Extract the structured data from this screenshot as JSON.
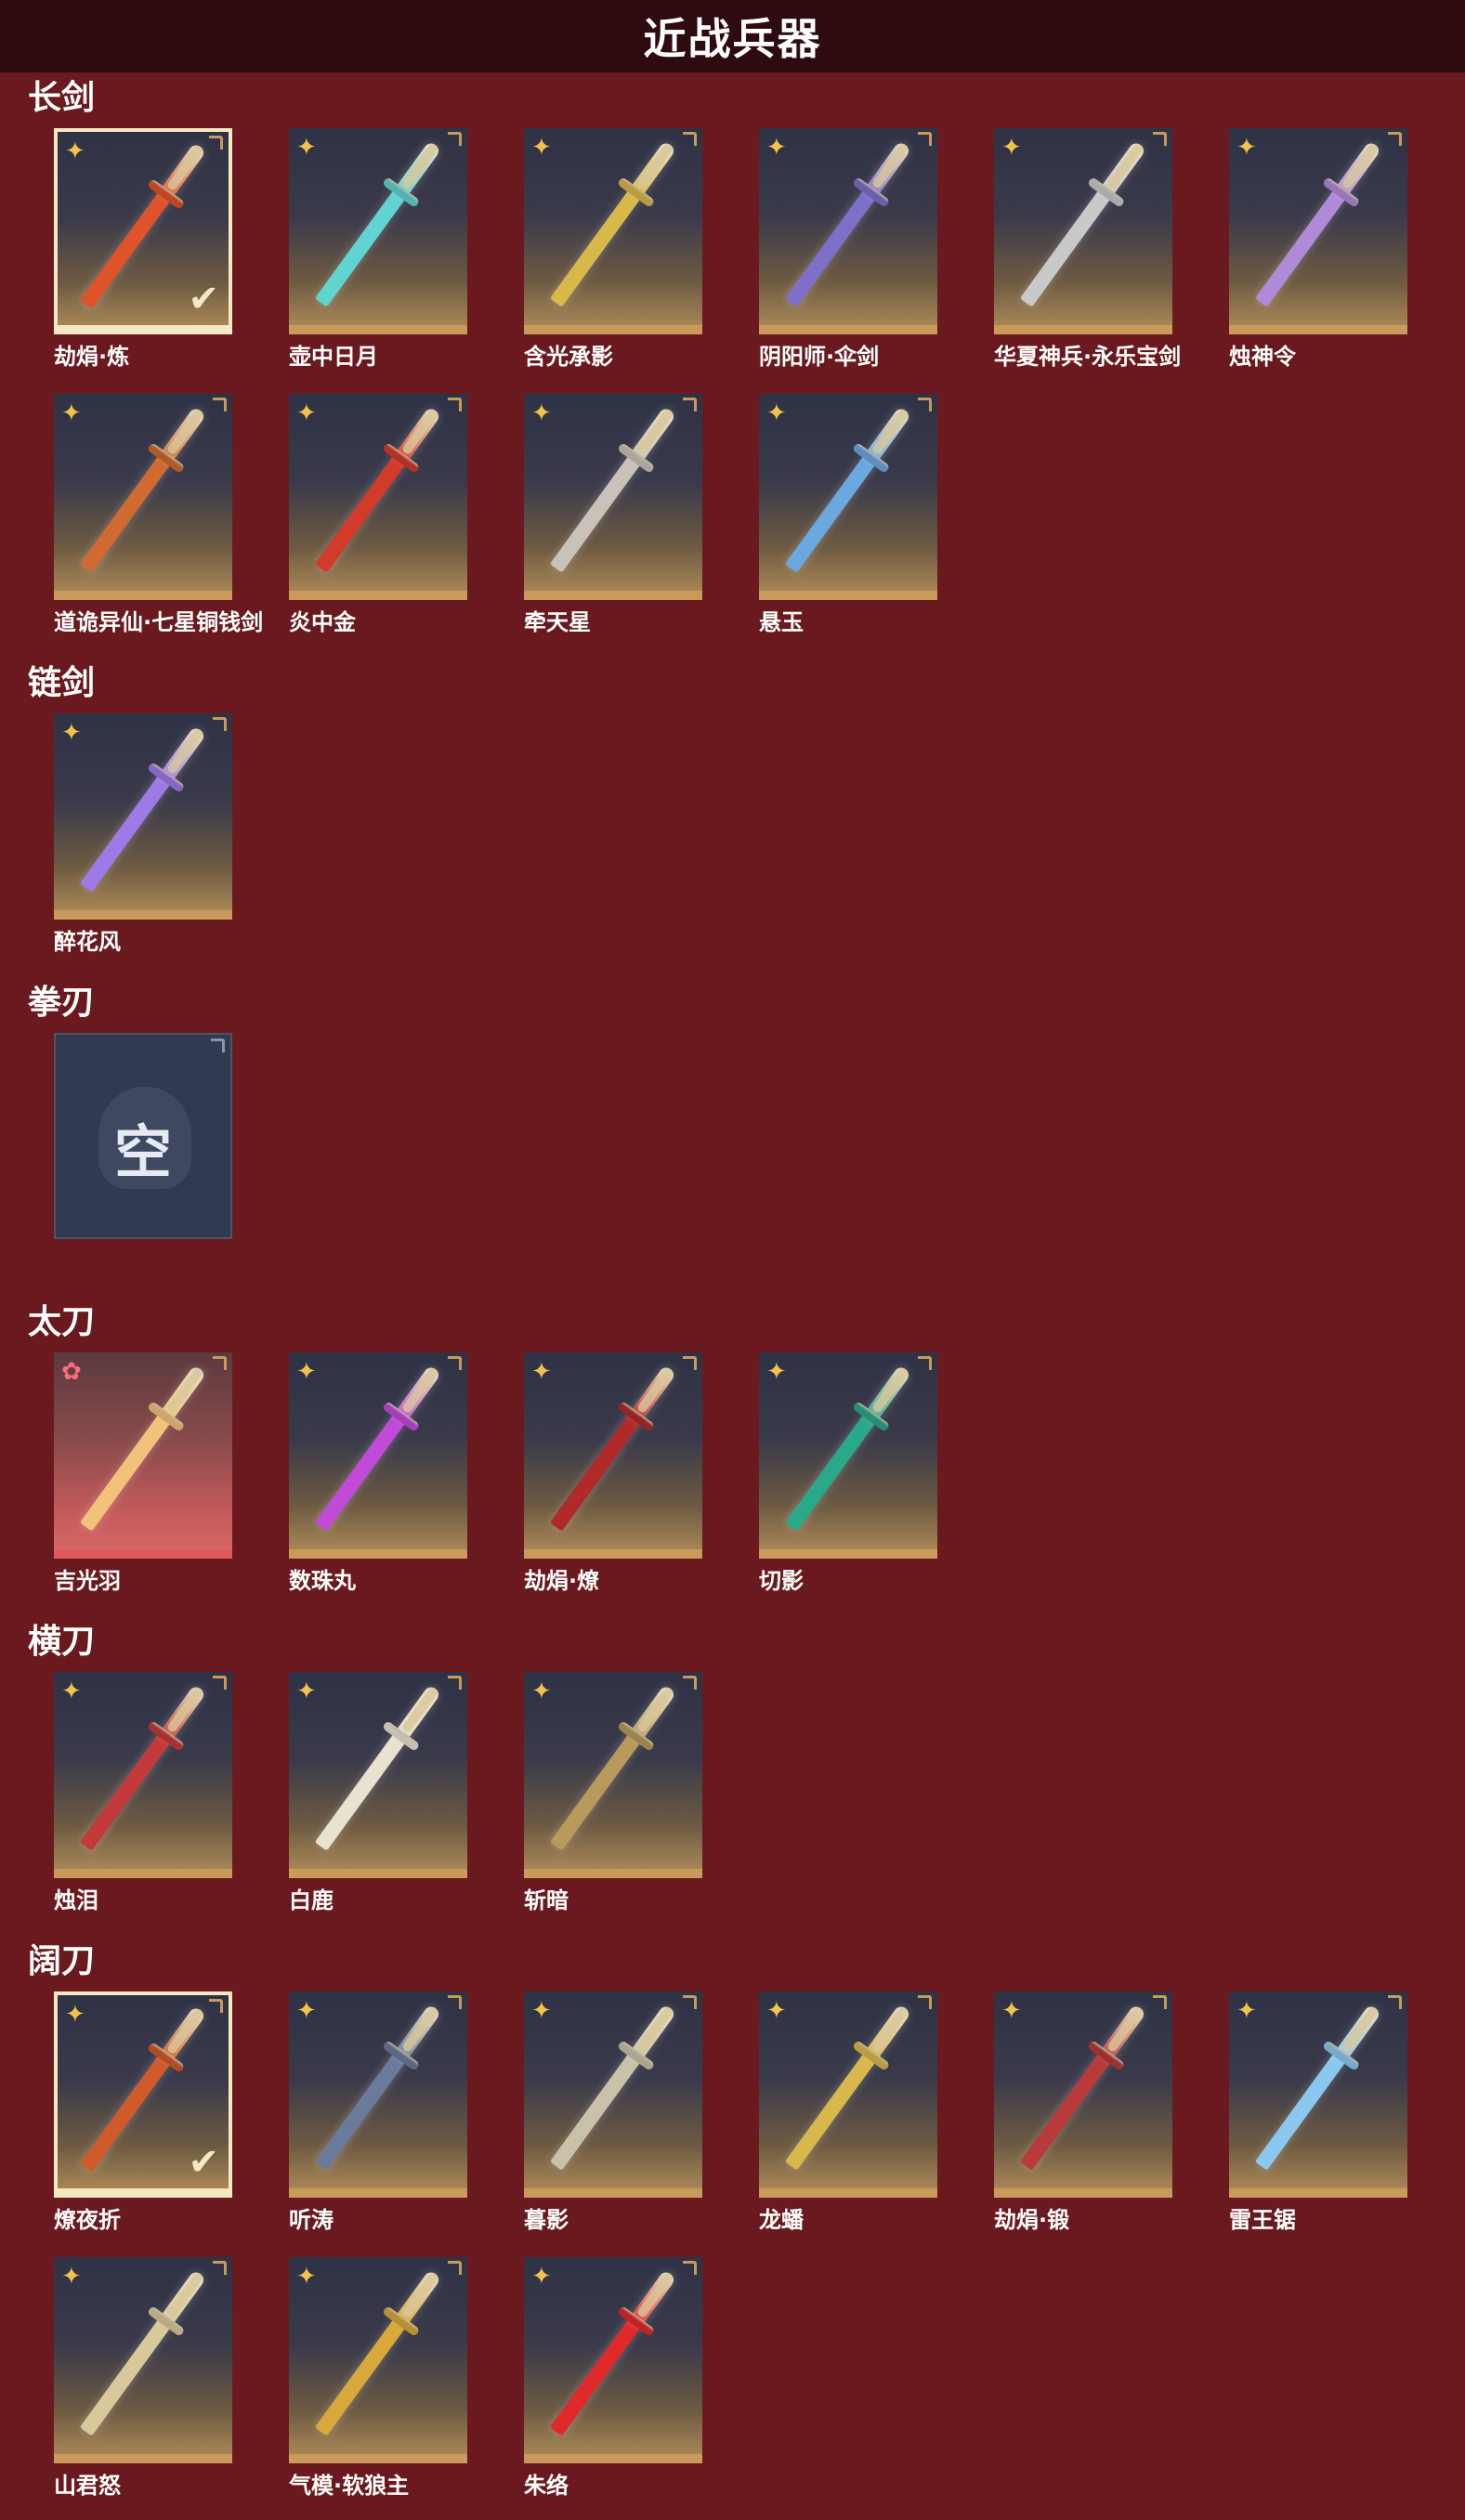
{
  "page": {
    "title": "近战兵器"
  },
  "icons": {
    "rarity": "four-point-star-icon",
    "rarity_pink": "flower-icon",
    "selected": "checkmark-icon",
    "corner": "corner-bracket-icon"
  },
  "colors": {
    "background": "#6a1a1e",
    "header": "#2e0b0e",
    "card_bottom": "#c99a5a",
    "rarity_gold": "#f2c24a",
    "rarity_pink": "#ff6a80"
  },
  "sections": [
    {
      "title": "长剑",
      "items": [
        {
          "name": "劫焆·炼",
          "selected": true,
          "color": "#e0522a"
        },
        {
          "name": "壶中日月",
          "color": "#5fd4d0"
        },
        {
          "name": "含光承影",
          "color": "#d9b84a"
        },
        {
          "name": "阴阳师·伞剑",
          "color": "#7e6fc9"
        },
        {
          "name": "华夏神兵·永乐宝剑",
          "color": "#c9c9c9"
        },
        {
          "name": "烛神令",
          "color": "#b08ad8"
        },
        {
          "name": "道诡异仙·七星铜钱剑",
          "color": "#d06a30"
        },
        {
          "name": "炎中金",
          "color": "#d23a2a"
        },
        {
          "name": "牵天星",
          "color": "#c9c2b8"
        },
        {
          "name": "悬玉",
          "color": "#6aa8e0"
        }
      ]
    },
    {
      "title": "链剑",
      "items": [
        {
          "name": "醉花风",
          "color": "#9d7ae8"
        }
      ]
    },
    {
      "title": "拳刃",
      "items": [
        {
          "empty": true,
          "empty_text": "空"
        }
      ]
    },
    {
      "title": "太刀",
      "items": [
        {
          "name": "吉光羽",
          "rarity": "pink",
          "color": "#f2c27a"
        },
        {
          "name": "数珠丸",
          "color": "#c24ad8"
        },
        {
          "name": "劫焆·燎",
          "color": "#b02a2a"
        },
        {
          "name": "切影",
          "color": "#2aa88a"
        }
      ]
    },
    {
      "title": "横刀",
      "items": [
        {
          "name": "烛泪",
          "color": "#c43a3a"
        },
        {
          "name": "白鹿",
          "color": "#e8e2d0"
        },
        {
          "name": "斩暗",
          "color": "#b89a5a"
        }
      ]
    },
    {
      "title": "阔刀",
      "items": [
        {
          "name": "燎夜折",
          "selected": true,
          "color": "#d05a2a"
        },
        {
          "name": "听涛",
          "color": "#6a7a9a"
        },
        {
          "name": "暮影",
          "color": "#c9c2a8"
        },
        {
          "name": "龙蟠",
          "color": "#d8b84a"
        },
        {
          "name": "劫焆·锻",
          "color": "#b83a3a"
        },
        {
          "name": "雷王锯",
          "color": "#8ac8f0"
        },
        {
          "name": "山君怒",
          "color": "#d8c89a"
        },
        {
          "name": "气模·软狼主",
          "color": "#d8a83a"
        },
        {
          "name": "朱络",
          "color": "#e02a2a"
        }
      ]
    }
  ]
}
